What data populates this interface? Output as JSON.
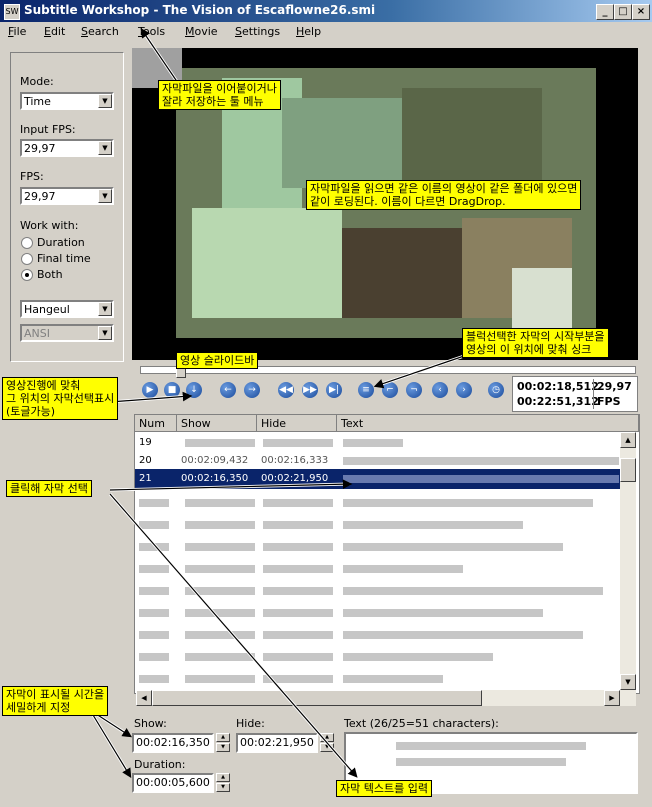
{
  "window": {
    "title": "Subtitle Workshop - The Vision of Escaflowne26.smi"
  },
  "menu": [
    "File",
    "Edit",
    "Search",
    "Tools",
    "Movie",
    "Settings",
    "Help"
  ],
  "left": {
    "mode_label": "Mode:",
    "mode_value": "Time",
    "input_fps_label": "Input FPS:",
    "input_fps_value": "29,97",
    "fps_label": "FPS:",
    "fps_value": "29,97",
    "work_with_label": "Work with:",
    "radios": [
      "Duration",
      "Final time",
      "Both"
    ],
    "charset_value": "Hangeul",
    "format_value": "ANSI"
  },
  "player": {
    "time_current": "00:02:18,512",
    "time_total": "00:22:51,312",
    "fps_value": "29,97",
    "fps_label": "FPS"
  },
  "grid": {
    "headers": [
      "Num",
      "Show",
      "Hide",
      "Text"
    ],
    "rows": [
      {
        "num": "19",
        "show": "",
        "hide": "",
        "text": ""
      },
      {
        "num": "20",
        "show": "00:02:09,432",
        "hide": "00:02:16,333",
        "text": ""
      },
      {
        "num": "21",
        "show": "00:02:16,350",
        "hide": "00:02:21,950",
        "text": ""
      }
    ]
  },
  "editor": {
    "show_label": "Show:",
    "show_value": "00:02:16,350",
    "hide_label": "Hide:",
    "hide_value": "00:02:21,950",
    "duration_label": "Duration:",
    "duration_value": "00:00:05,600",
    "text_label": "Text (26/25=51 characters):"
  },
  "annotations": {
    "tools": "자막파일을 이어붙이거나\n잘라 저장하는 툴 메뉴",
    "dragdrop": "자막파일을 읽으면 같은 이름의 영상이 같은 폴더에 있으면\n같이 로딩된다. 이름이 다르면 DragDrop.",
    "sync": "블럭선택한 자막의 시작부분을\n영상의 이 위치에 맞춰 싱크",
    "slider": "영상 슬라이드바",
    "follow": "영상진행에 맞춰\n그 위치의 자막선택표시\n(토글가능)",
    "click_select": "클릭해 자막 선택",
    "time_set": "자막이 표시될 시간을\n세밀하게 지정",
    "text_input": "자막 텍스트를 입력"
  }
}
